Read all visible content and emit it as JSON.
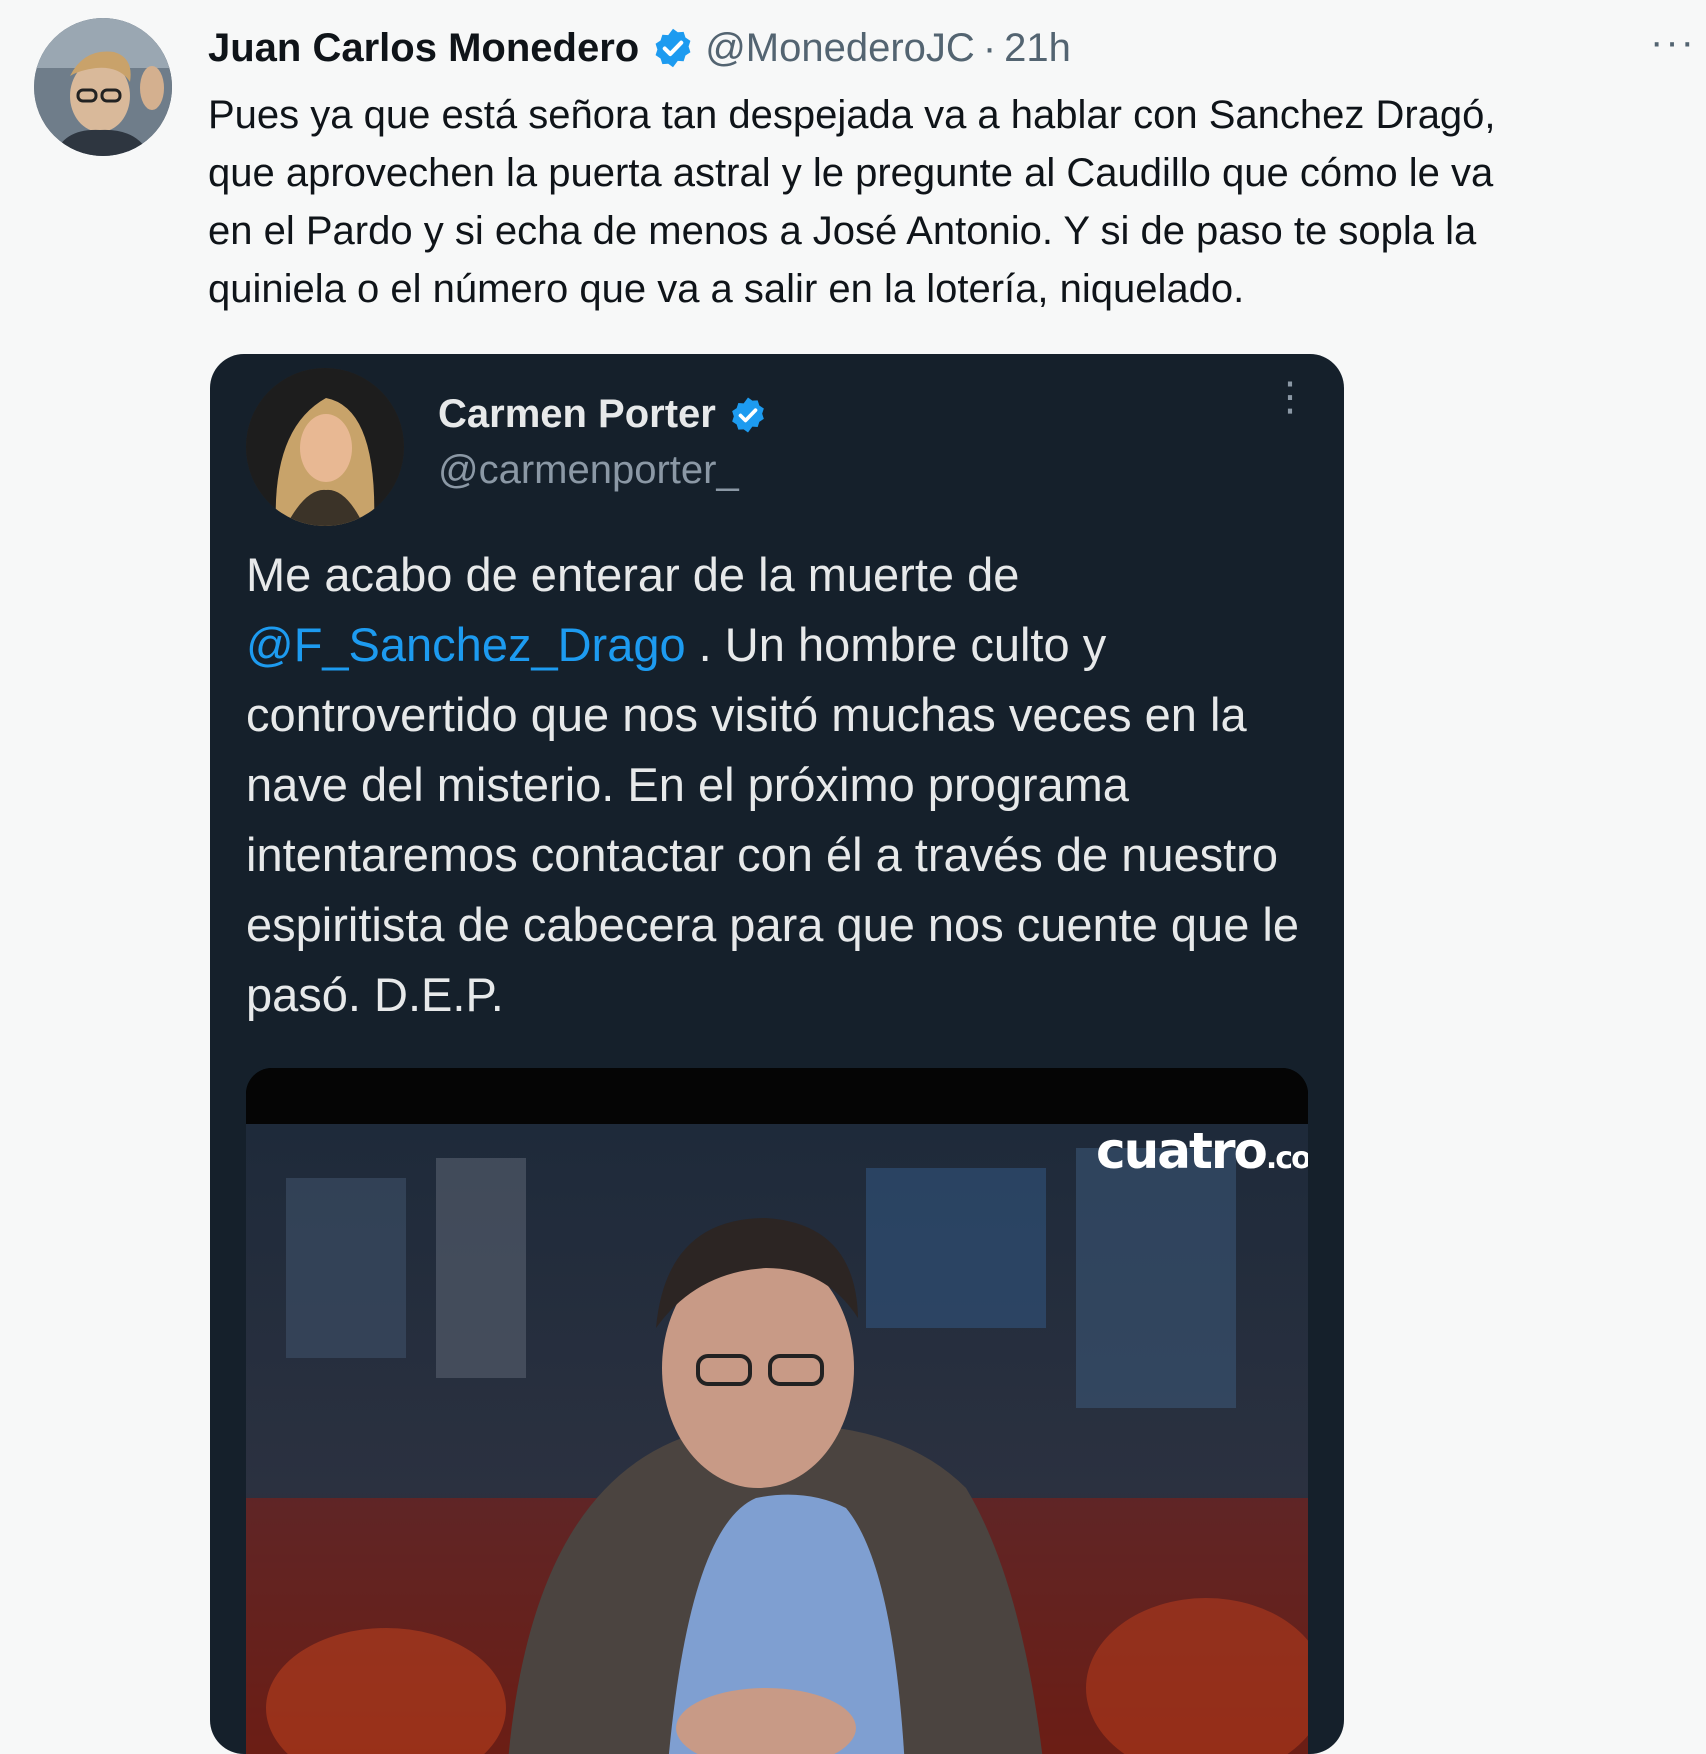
{
  "tweet": {
    "author_name": "Juan Carlos Monedero",
    "handle": "@MonederoJC",
    "separator": "·",
    "time": "21h",
    "more_label": "···",
    "text": "Pues ya que está señora tan despejada va a hablar con Sanchez Dragó,\nque aprovechen  la puerta astral y le pregunte al Caudillo que cómo le va\nen el Pardo y si echa de menos a José Antonio. Y si de paso te sopla la\nquiniela o el número que va a salir en la lotería, niquelado."
  },
  "quoted": {
    "author_name": "Carmen Porter",
    "handle": "@carmenporter_",
    "more_label": "⋮",
    "text_before": "Me acabo de enterar de la muerte de ",
    "mention": "@F_Sanchez_Drago",
    "text_after": " . Un hombre culto y controvertido que nos visitó muchas veces en la nave del misterio. En el próximo programa intentaremos contactar con él a través de nuestro espiritista de cabecera para que nos cuente que le pasó. D.E.P.",
    "media_watermark": "cuatro",
    "media_watermark_suffix": ".co"
  },
  "colors": {
    "verified": "#1d9bf0",
    "link": "#1d9bf0",
    "quote_bg": "#15202b",
    "page_bg": "#f7f8f8"
  },
  "icons": [
    "verified-badge-icon",
    "more-options-icon"
  ]
}
